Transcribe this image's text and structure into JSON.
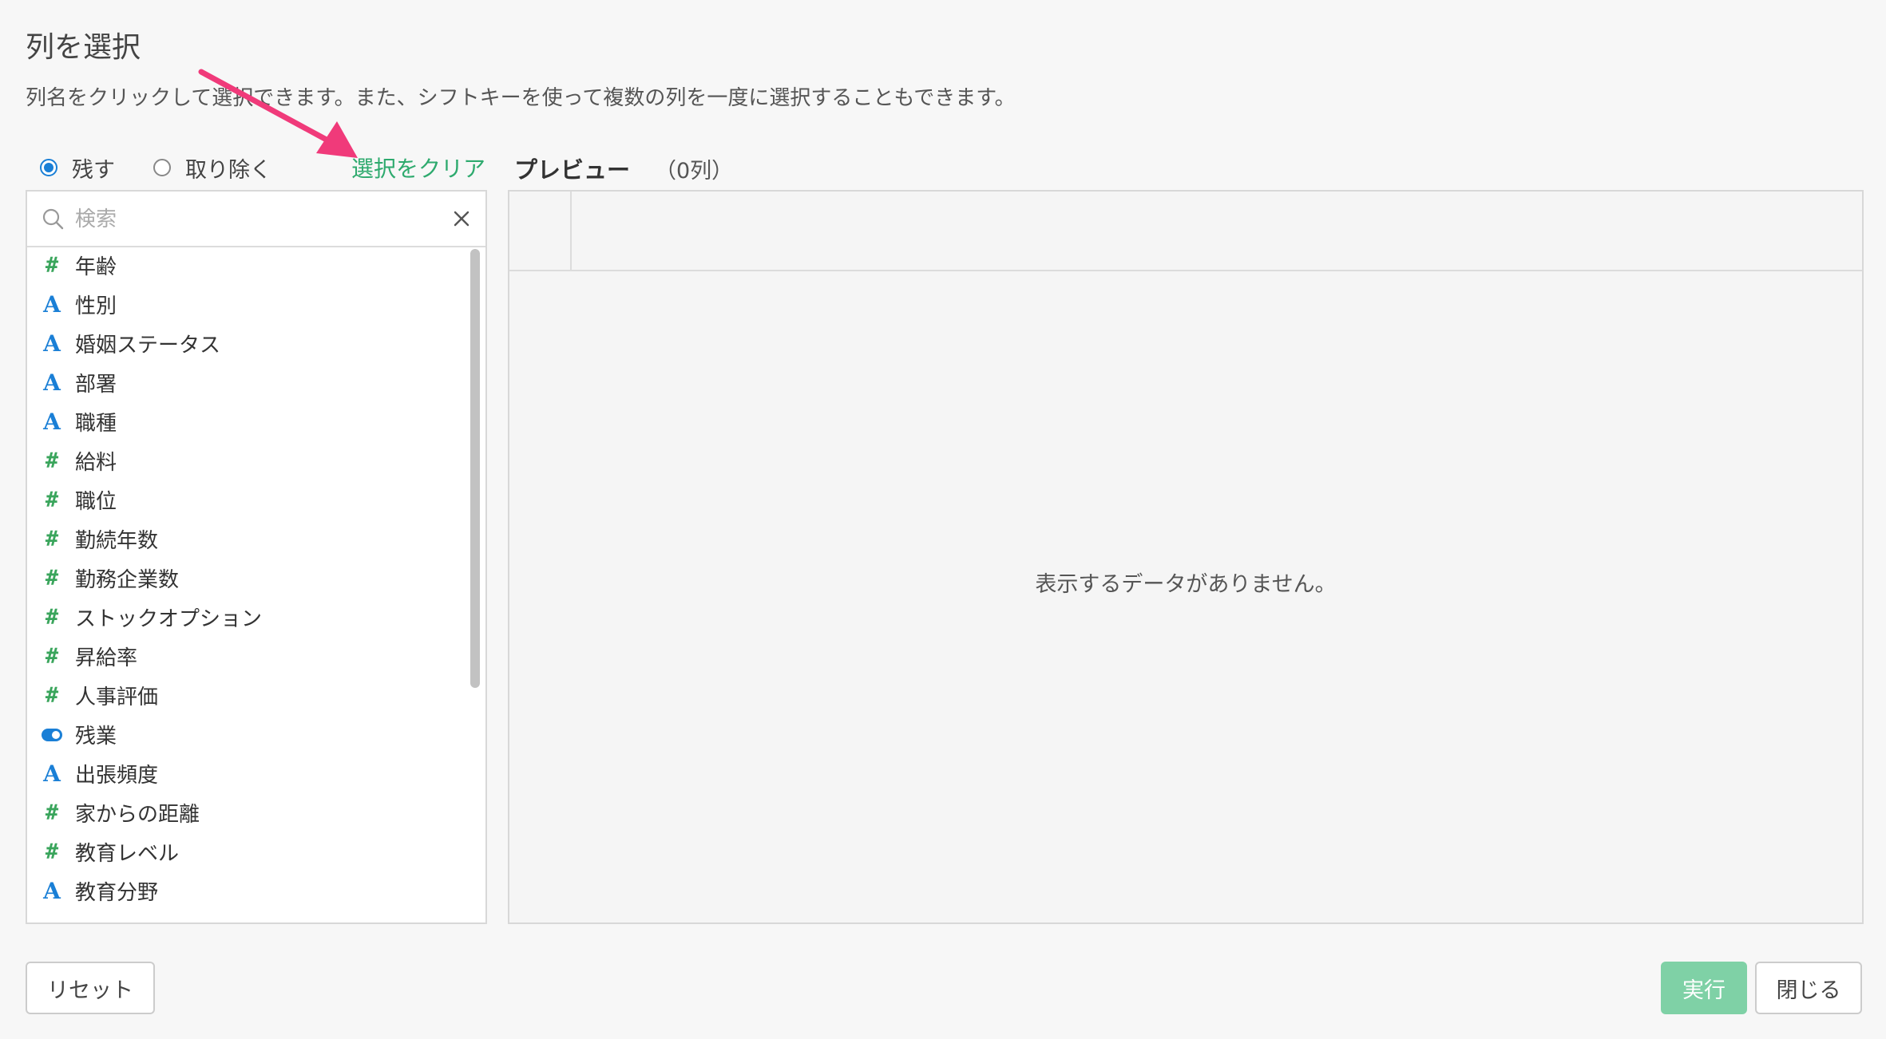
{
  "dialog": {
    "title": "列を選択",
    "description": "列名をクリックして選択できます。また、シフトキーを使って複数の列を一度に選択することもできます。"
  },
  "mode": {
    "options": [
      "残す",
      "取り除く"
    ],
    "selected": "残す",
    "clear_label": "選択をクリア"
  },
  "search": {
    "placeholder": "検索",
    "value": ""
  },
  "columns": [
    {
      "type": "number",
      "icon": "hash-icon",
      "glyph": "#",
      "name": "年齢"
    },
    {
      "type": "string",
      "icon": "text-type-icon",
      "glyph": "A",
      "name": "性別"
    },
    {
      "type": "string",
      "icon": "text-type-icon",
      "glyph": "A",
      "name": "婚姻ステータス"
    },
    {
      "type": "string",
      "icon": "text-type-icon",
      "glyph": "A",
      "name": "部署"
    },
    {
      "type": "string",
      "icon": "text-type-icon",
      "glyph": "A",
      "name": "職種"
    },
    {
      "type": "number",
      "icon": "hash-icon",
      "glyph": "#",
      "name": "給料"
    },
    {
      "type": "number",
      "icon": "hash-icon",
      "glyph": "#",
      "name": "職位"
    },
    {
      "type": "number",
      "icon": "hash-icon",
      "glyph": "#",
      "name": "勤続年数"
    },
    {
      "type": "number",
      "icon": "hash-icon",
      "glyph": "#",
      "name": "勤務企業数"
    },
    {
      "type": "number",
      "icon": "hash-icon",
      "glyph": "#",
      "name": "ストックオプション"
    },
    {
      "type": "number",
      "icon": "hash-icon",
      "glyph": "#",
      "name": "昇給率"
    },
    {
      "type": "number",
      "icon": "hash-icon",
      "glyph": "#",
      "name": "人事評価"
    },
    {
      "type": "boolean",
      "icon": "toggle-icon",
      "glyph": "",
      "name": "残業"
    },
    {
      "type": "string",
      "icon": "text-type-icon",
      "glyph": "A",
      "name": "出張頻度"
    },
    {
      "type": "number",
      "icon": "hash-icon",
      "glyph": "#",
      "name": "家からの距離"
    },
    {
      "type": "number",
      "icon": "hash-icon",
      "glyph": "#",
      "name": "教育レベル"
    },
    {
      "type": "string",
      "icon": "text-type-icon",
      "glyph": "A",
      "name": "教育分野"
    }
  ],
  "preview": {
    "title": "プレビュー",
    "count": "（0列）",
    "empty_message": "表示するデータがありません。"
  },
  "buttons": {
    "reset": "リセット",
    "run": "実行",
    "close": "閉じる"
  },
  "colors": {
    "accent_green": "#2eaa6e",
    "run_button": "#7fd1a6",
    "number_type": "#3aa55c",
    "string_type": "#1a7fd6",
    "annotation_arrow": "#f03a7a"
  }
}
